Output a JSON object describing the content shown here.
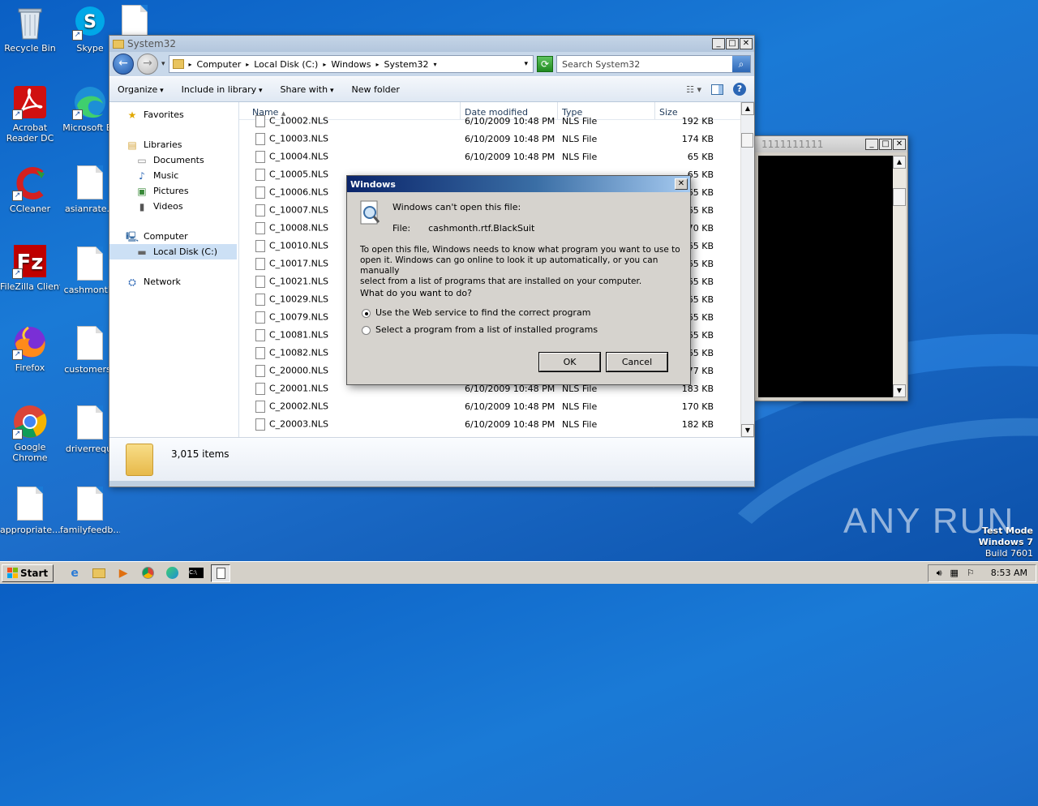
{
  "desktop": {
    "icons": [
      {
        "id": "recycle-bin",
        "label": "Recycle Bin",
        "icon": "recycle-bin-icon"
      },
      {
        "id": "skype",
        "label": "Skype",
        "icon": "skype-icon"
      },
      {
        "id": "acrobat",
        "label": "Acrobat Reader DC",
        "icon": "acrobat-icon"
      },
      {
        "id": "edge",
        "label": "Microsoft Ed",
        "icon": "edge-icon"
      },
      {
        "id": "ccleaner",
        "label": "CCleaner",
        "icon": "ccleaner-icon"
      },
      {
        "id": "asianrate",
        "label": "asianrate.p",
        "icon": "document-icon"
      },
      {
        "id": "filezilla",
        "label": "FileZilla Client",
        "icon": "filezilla-icon"
      },
      {
        "id": "cashmonth",
        "label": "cashmonth.",
        "icon": "document-icon"
      },
      {
        "id": "firefox",
        "label": "Firefox",
        "icon": "firefox-icon"
      },
      {
        "id": "customersc",
        "label": "customersc",
        "icon": "document-icon"
      },
      {
        "id": "chrome",
        "label": "Google Chrome",
        "icon": "chrome-icon"
      },
      {
        "id": "driverrequi",
        "label": "driverrequi",
        "icon": "document-icon"
      },
      {
        "id": "appropriate",
        "label": "appropriate...",
        "icon": "document-icon"
      },
      {
        "id": "familyfeedb",
        "label": "familyfeedb...",
        "icon": "document-icon"
      }
    ],
    "watermark": {
      "brand": "ANY RUN",
      "mode": "Test Mode",
      "os": "Windows 7",
      "build": "Build 7601"
    }
  },
  "explorer": {
    "title": "System32",
    "breadcrumb": [
      "Computer",
      "Local Disk (C:)",
      "Windows",
      "System32"
    ],
    "search_placeholder": "Search System32",
    "toolbar": {
      "organize": "Organize",
      "include": "Include in library",
      "share": "Share with",
      "new_folder": "New folder"
    },
    "nav": {
      "favorites": "Favorites",
      "libraries": "Libraries",
      "documents": "Documents",
      "music": "Music",
      "pictures": "Pictures",
      "videos": "Videos",
      "computer": "Computer",
      "local_disk": "Local Disk (C:)",
      "network": "Network"
    },
    "columns": {
      "name": "Name",
      "date": "Date modified",
      "type": "Type",
      "size": "Size"
    },
    "files": [
      {
        "name": "C_10002.NLS",
        "date": "6/10/2009 10:48 PM",
        "type": "NLS File",
        "size": "192 KB"
      },
      {
        "name": "C_10003.NLS",
        "date": "6/10/2009 10:48 PM",
        "type": "NLS File",
        "size": "174 KB"
      },
      {
        "name": "C_10004.NLS",
        "date": "6/10/2009 10:48 PM",
        "type": "NLS File",
        "size": "65 KB"
      },
      {
        "name": "C_10005.NLS",
        "date": "",
        "type": "",
        "size": "65 KB"
      },
      {
        "name": "C_10006.NLS",
        "date": "",
        "type": "",
        "size": "65 KB"
      },
      {
        "name": "C_10007.NLS",
        "date": "",
        "type": "",
        "size": "65 KB"
      },
      {
        "name": "C_10008.NLS",
        "date": "",
        "type": "",
        "size": "70 KB"
      },
      {
        "name": "C_10010.NLS",
        "date": "",
        "type": "",
        "size": "65 KB"
      },
      {
        "name": "C_10017.NLS",
        "date": "",
        "type": "",
        "size": "65 KB"
      },
      {
        "name": "C_10021.NLS",
        "date": "",
        "type": "",
        "size": "65 KB"
      },
      {
        "name": "C_10029.NLS",
        "date": "",
        "type": "",
        "size": "65 KB"
      },
      {
        "name": "C_10079.NLS",
        "date": "",
        "type": "",
        "size": "65 KB"
      },
      {
        "name": "C_10081.NLS",
        "date": "",
        "type": "",
        "size": "65 KB"
      },
      {
        "name": "C_10082.NLS",
        "date": "",
        "type": "",
        "size": "65 KB"
      },
      {
        "name": "C_20000.NLS",
        "date": "",
        "type": "",
        "size": "77 KB"
      },
      {
        "name": "C_20001.NLS",
        "date": "6/10/2009 10:48 PM",
        "type": "NLS File",
        "size": "183 KB"
      },
      {
        "name": "C_20002.NLS",
        "date": "6/10/2009 10:48 PM",
        "type": "NLS File",
        "size": "170 KB"
      },
      {
        "name": "C_20003.NLS",
        "date": "6/10/2009 10:48 PM",
        "type": "NLS File",
        "size": "182 KB"
      }
    ],
    "status": "3,015 items"
  },
  "console": {
    "title": "1111111111"
  },
  "dialog": {
    "title": "Windows",
    "heading": "Windows can't open this file:",
    "file_label": "File:",
    "file_name": "cashmonth.rtf.BlackSuit",
    "desc1": "To open this file, Windows needs to know what program you want to use to",
    "desc2": "open it. Windows can go online to look it up automatically, or you can manually",
    "desc3": "select from a list of programs that are installed on your computer.",
    "question": "What do you want to do?",
    "option1": "Use the Web service to find the correct program",
    "option2": "Select a program from a list of installed programs",
    "ok": "OK",
    "cancel": "Cancel"
  },
  "taskbar": {
    "start": "Start",
    "clock": "8:53 AM"
  }
}
